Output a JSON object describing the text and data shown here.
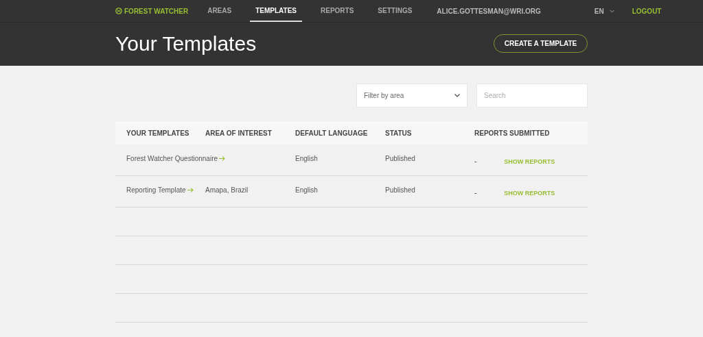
{
  "nav": {
    "brand": "FOREST WATCHER",
    "links": [
      {
        "label": "AREAS",
        "selected": false
      },
      {
        "label": "TEMPLATES",
        "selected": true
      },
      {
        "label": "REPORTS",
        "selected": false
      },
      {
        "label": "SETTINGS",
        "selected": false
      }
    ],
    "user": "ALICE.GOTTESMAN@WRI.ORG",
    "language": "EN",
    "logout": "LOGOUT"
  },
  "header": {
    "title": "Your Templates",
    "button": "CREATE A TEMPLATE"
  },
  "filters": {
    "area": {
      "placeholder": "Filter by area"
    },
    "search": {
      "placeholder": "Search"
    }
  },
  "table": {
    "columns": [
      "YOUR TEMPLATES",
      "AREA OF INTEREST",
      "DEFAULT LANGUAGE",
      "STATUS",
      "REPORTS SUBMITTED"
    ],
    "rows": [
      {
        "template": "Forest Watcher Questionnaire",
        "area": "",
        "language": "English",
        "status": "Published",
        "reports": "-",
        "action": "SHOW REPORTS"
      },
      {
        "template": "Reporting Template",
        "area": "Amapa, Brazil",
        "language": "English",
        "status": "Published",
        "reports": "-",
        "action": "SHOW REPORTS"
      }
    ]
  }
}
